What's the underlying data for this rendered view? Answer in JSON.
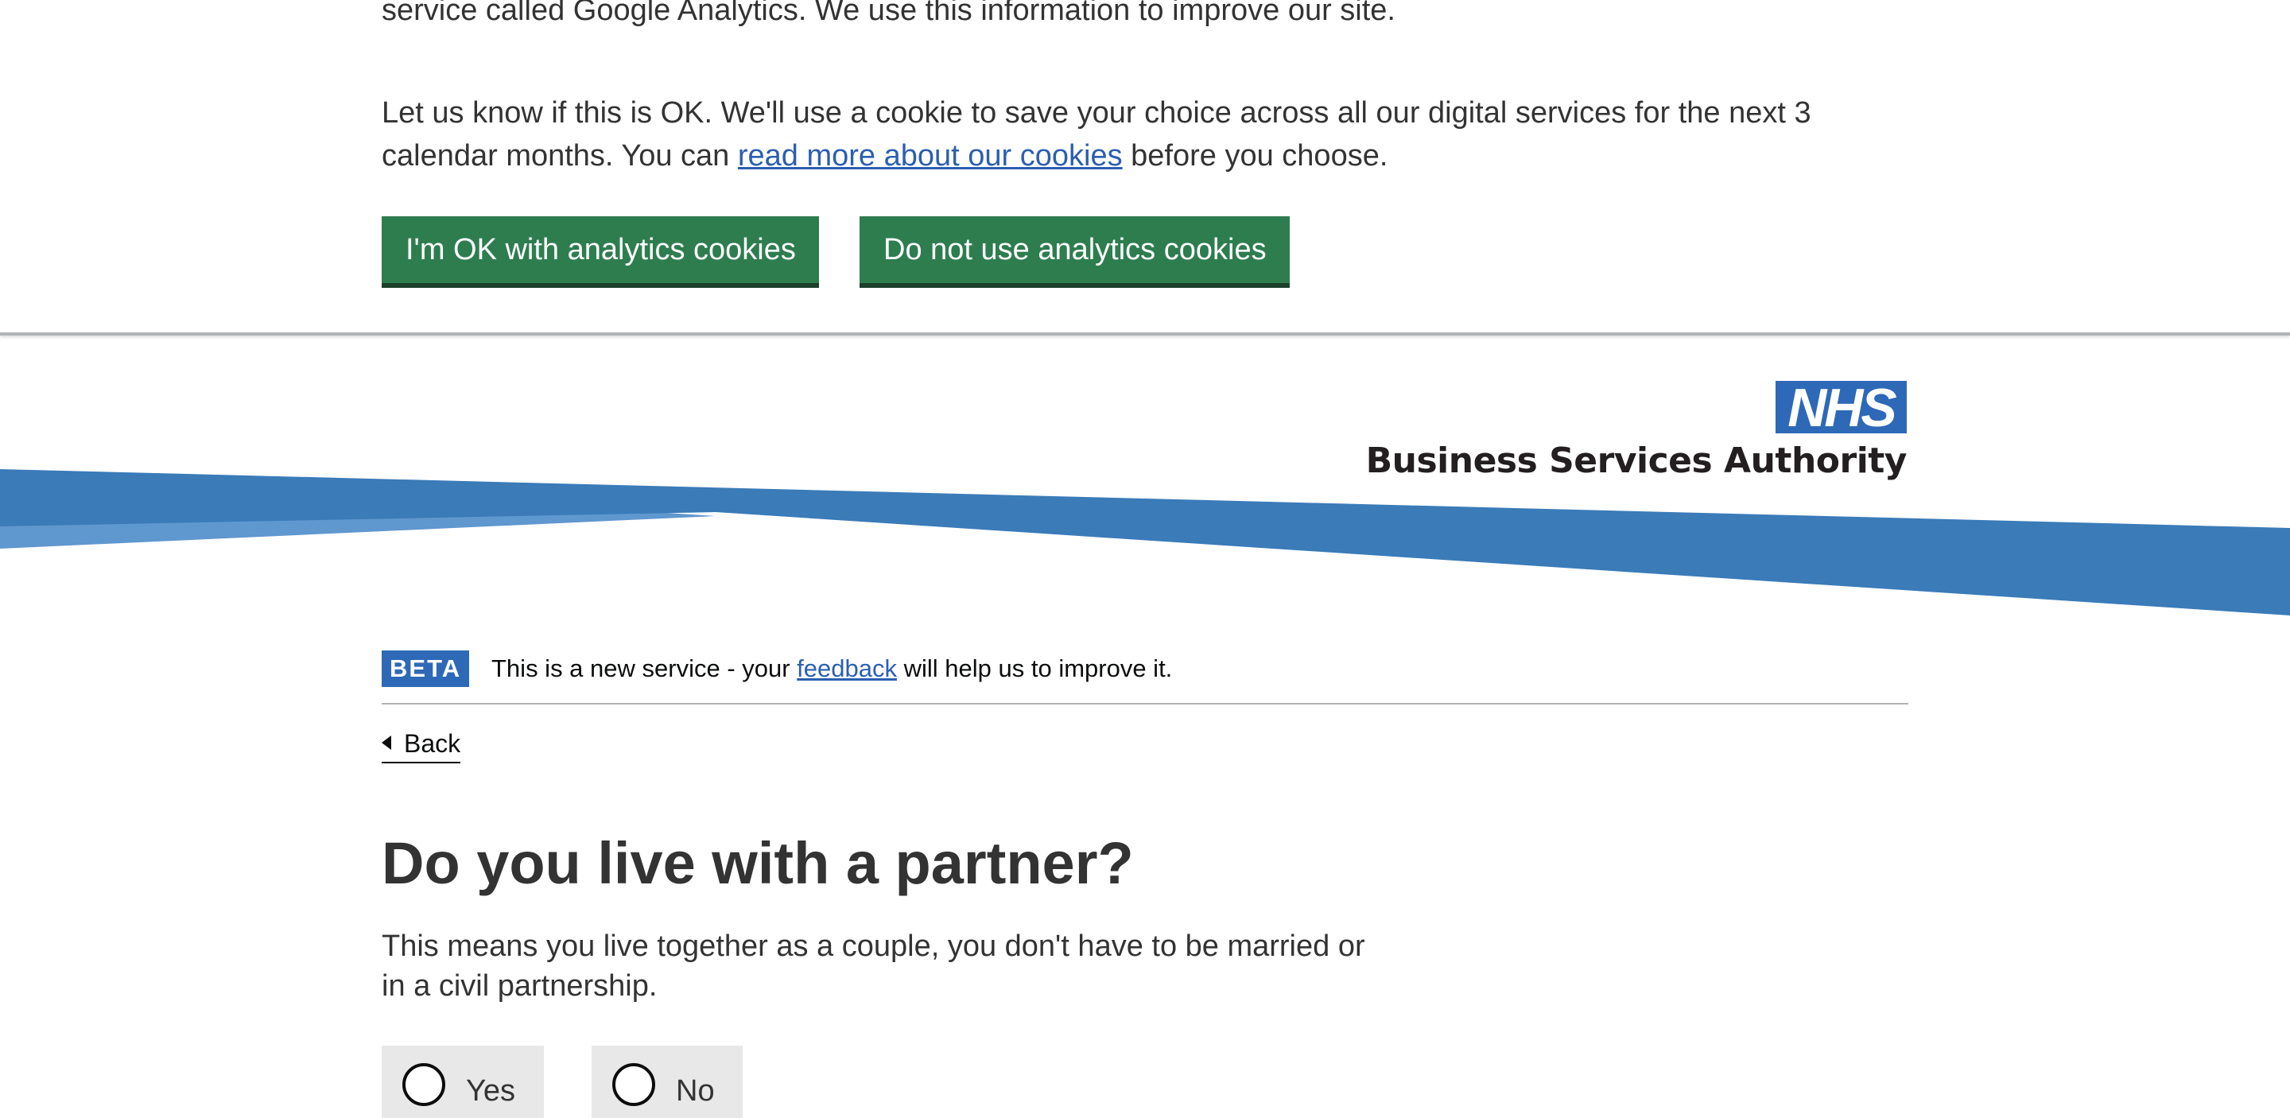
{
  "cookie_banner": {
    "paragraph_1": "service called Google Analytics. We use this information to improve our site.",
    "paragraph_2_line_1": "Let us know if this is OK. We'll use a cookie to save your choice across all our digital services for the next 3",
    "paragraph_2_line_2_before": "calendar months. You can ",
    "paragraph_2_link": "read more about our cookies",
    "paragraph_2_line_2_after": " before you choose.",
    "accept_button": "I'm OK with analytics cookies",
    "reject_button": "Do not use analytics cookies"
  },
  "header": {
    "logo_text": "NHS",
    "organisation": "Business Services Authority",
    "colors": {
      "nhs_blue": "#2e69b7",
      "swoosh_dark": "#3a7bb8",
      "swoosh_light": "#5f97cf"
    }
  },
  "phase_banner": {
    "tag": "BETA",
    "text_before": "This is a new service - your ",
    "link": "feedback",
    "text_after": " will help us to improve it."
  },
  "back_link": "Back",
  "question": {
    "title": "Do you live with a partner?",
    "hint": "This means you live together as a couple, you don't have to be married or in a civil partnership.",
    "options": [
      {
        "label": "Yes",
        "selected": false
      },
      {
        "label": "No",
        "selected": false
      }
    ]
  },
  "colors": {
    "button_green": "#2e7d4f",
    "link_blue": "#2b5fb0",
    "text": "#333333"
  }
}
